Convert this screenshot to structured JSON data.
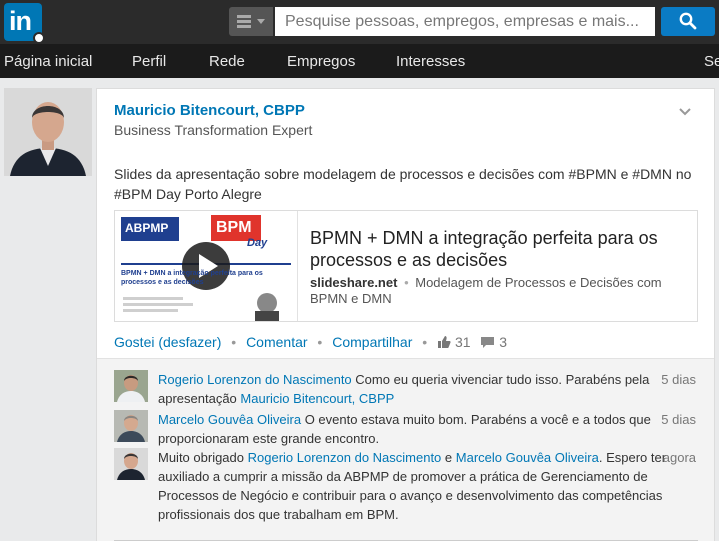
{
  "header": {
    "logo_text": "in",
    "search_placeholder": "Pesquise pessoas, empregos, empresas e mais..."
  },
  "nav": {
    "items": [
      {
        "label": "Página inicial"
      },
      {
        "label": "Perfil"
      },
      {
        "label": "Rede"
      },
      {
        "label": "Empregos"
      },
      {
        "label": "Interesses"
      },
      {
        "label": "Se"
      }
    ]
  },
  "post": {
    "author_name": "Mauricio Bitencourt, CBPP",
    "author_headline": "Business Transformation Expert",
    "text": "Slides da apresentação sobre modelagem de processos e decisões com #BPMN e #DMN no #BPM Day Porto Alegre",
    "attachment": {
      "title": "BPMN + DMN a integração perfeita para os processos e as decisões",
      "source": "slideshare.net",
      "description": "Modelagem de Processos e Decisões com BPMN e DMN",
      "thumb_logo_left": "ABPMP",
      "thumb_logo_right": "BPM",
      "thumb_logo_day": "Day",
      "thumb_caption": "BPMN + DMN a integração perfeita para os processos e as decisões"
    },
    "actions": {
      "like_label": "Gostei (desfazer)",
      "comment_label": "Comentar",
      "share_label": "Compartilhar",
      "likes_count": "31",
      "comments_count": "3"
    }
  },
  "comments": [
    {
      "author": "Rogerio Lorenzon do Nascimento",
      "text_before": "Como eu queria vivenciar tudo isso. Parabéns pela apresentação",
      "mention": "Mauricio Bitencourt, CBPP",
      "time": "5 dias"
    },
    {
      "author": "Marcelo Gouvêa Oliveira",
      "text_before": "O evento estava muito bom. Parabéns a você e a todos que proporcionaram este grande encontro.",
      "time": "5 dias"
    },
    {
      "prefix": "Muito obrigado",
      "mention1": "Rogerio Lorenzon do Nascimento",
      "and": "e",
      "mention2": "Marcelo Gouvêa Oliveira",
      "text_after": ". Espero ter auxiliado a cumprir a missão da ABPMP de promover a prática de Gerenciamento de Processos de Negócio e contribuir para o avanço e desenvolvimento das competências profissionais dos que trabalham em BPM.",
      "time": "agora"
    }
  ],
  "colors": {
    "topbar": "#2b2b2b",
    "navbar": "#1b1b1b",
    "brand": "#0077b5",
    "search_button": "#0a7bc4"
  }
}
